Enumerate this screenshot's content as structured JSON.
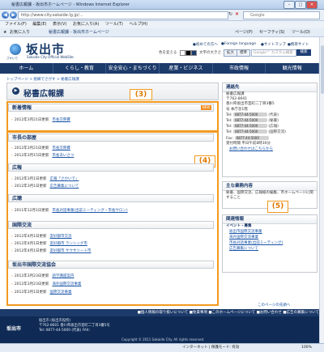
{
  "browser": {
    "window_title": "秘書広報課 - 坂出市ホームページ - Windows Internet Explorer",
    "url": "http://www.city.sakaide.lg.jp/...",
    "search_placeholder": "Google",
    "menu": [
      "ファイル(F)",
      "編集(E)",
      "表示(V)",
      "お気に入り(A)",
      "ツール(T)",
      "ヘルプ(H)"
    ],
    "favorites_label": "お気に入り",
    "tab_label": "秘書広報課 - 坂出市ホームページ",
    "toolbar_items": [
      "ページ(P)",
      "セーフティ(S)",
      "ツール(O)"
    ],
    "status_left": "",
    "status_zone": "インターネット | 保護モード: 有効",
    "zoom": "100%"
  },
  "site": {
    "logo_text": "坂出市",
    "logo_sub": "Sakaide City Official WebSite",
    "logo_left_sub": "さかいで",
    "top_links": [
      "●初めての方へ",
      "●Foreign language",
      "●サイトマップ",
      "●携帯サイト"
    ],
    "utility_label": "色を変える",
    "font_label": "文字の大きさ",
    "font_btn_large": "拡大",
    "font_btn_std": "標準",
    "search_placeholder": "Google™ カスタム検索",
    "search_button": "検索",
    "gnav": [
      "ホーム",
      "くらし・教育",
      "安全安心・まちづくり",
      "産業・ビジネス",
      "市政情報",
      "観光情報"
    ]
  },
  "breadcrumb": "トップページ > 組織でさがす > 秘書広報課",
  "page_title": "秘書広報課",
  "badges": {
    "b3": "(3)",
    "b4": "(4)",
    "b5": "(5)"
  },
  "sections": {
    "new_info": {
      "title": "新着情報",
      "new_badge": "NEW",
      "rows": [
        {
          "date": "2012年3月21日更新",
          "link": "市長交際費"
        }
      ]
    },
    "mayor": {
      "title": "市長の部屋",
      "rows": [
        {
          "date": "2012年3月21日更新",
          "link": "市長交際費"
        },
        {
          "date": "2012年3月15日更新",
          "link": "市長あいさつ"
        }
      ]
    },
    "pr": {
      "title": "広報",
      "rows": [
        {
          "date": "2012年3月1日更新",
          "link": "広報「さかいで」"
        },
        {
          "date": "2012年3月1日更新",
          "link": "広告募集について"
        }
      ]
    },
    "hearing": {
      "title": "広聴",
      "rows": [
        {
          "date": "2011年12月1日更新",
          "link": "市長対話事業(出前ミーティング・市長サロン)"
        }
      ]
    },
    "intl": {
      "title": "国際交流",
      "rows": [
        {
          "date": "2012年4月1日更新",
          "link": "友好都市交流"
        },
        {
          "date": "2012年4月1日更新",
          "link": "友好都市 ランシング市"
        },
        {
          "date": "2012年4月1日更新",
          "link": "友好都市 サウサリート市"
        }
      ]
    },
    "assoc": {
      "title": "坂出市国際交流協会",
      "rows": [
        {
          "date": "2012年3月23日更新",
          "link": "語学講座案内"
        },
        {
          "date": "2012年3月23日更新",
          "link": "海外国際交流事業"
        },
        {
          "date": "2012年3月1日更新",
          "link": "国際交流事業"
        }
      ]
    }
  },
  "contact": {
    "title": "連絡先",
    "lines": [
      "秘書広報課",
      "〒762-8601",
      "香川県坂出市室町二丁目3番5",
      "号 本庁舎1階"
    ],
    "tels": [
      {
        "label": "Tel:",
        "num": "0877-44-5000",
        "note": "(代表)"
      },
      {
        "label": "Tel:",
        "num": "0877-44-5000",
        "note": "(秘書)"
      },
      {
        "label": "Tel:",
        "num": "0877-44-5000",
        "note": "(広報)"
      },
      {
        "label": "Tel:",
        "num": "0877-44-5000",
        "note": "(国際交流)"
      },
      {
        "label": "Fax:",
        "num": "0877-44-5000",
        "note": ""
      }
    ],
    "office_hours": "受付時間 平日午前8時30分",
    "email_link": "お問い合わせはこちらから"
  },
  "duties": {
    "title": "主な業務内容",
    "text": "秘書、国際交流、広報紙の編集、市ホームページに関すること"
  },
  "related": {
    "title": "関連情報",
    "sub": "イベント・募集",
    "links": [
      "坂出市国際交流事業",
      "海外国際交流事業",
      "市長対話事業(出前ミーティング)",
      "広告募集について"
    ]
  },
  "footer": {
    "links": [
      "■個人情報の取り扱いについて",
      "■免責事項",
      "■このホームページについて",
      "■お問い合わせ",
      "■広告の募集について"
    ],
    "logo": "坂出市",
    "lines": [
      "坂出市 (坂出市役所)",
      "〒762-8601 香川県坂出市室町二丁目3番5号",
      "Tel: 0877-44-5000 (代表) FAX:"
    ],
    "copyright": "Copyright © 2011 Sakaide City. All rights reserved.",
    "page_top": "このページの先頭へ"
  }
}
